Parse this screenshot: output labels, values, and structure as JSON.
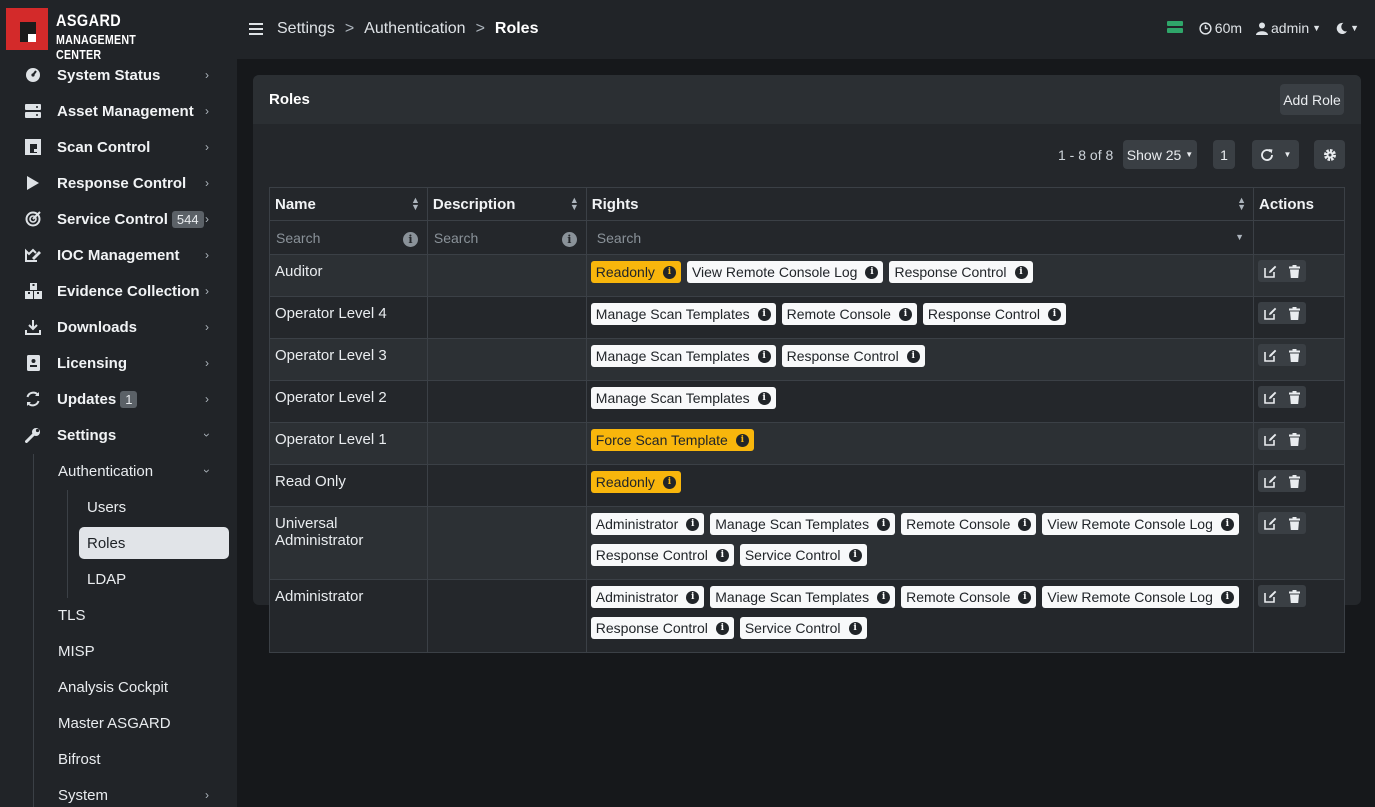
{
  "brand": {
    "line1": "ASGARD",
    "line2": "MANAGEMENT CENTER"
  },
  "sidebar": {
    "items": [
      {
        "label": "System Status",
        "icon": "dashboard-icon"
      },
      {
        "label": "Asset Management",
        "icon": "server-icon"
      },
      {
        "label": "Scan Control",
        "icon": "scan-icon"
      },
      {
        "label": "Response Control",
        "icon": "play-icon"
      },
      {
        "label": "Service Control",
        "icon": "radar-icon",
        "badge": "544"
      },
      {
        "label": "IOC Management",
        "icon": "chart-edit-icon"
      },
      {
        "label": "Evidence Collection",
        "icon": "boxes-icon"
      },
      {
        "label": "Downloads",
        "icon": "download-icon"
      },
      {
        "label": "Licensing",
        "icon": "license-icon"
      },
      {
        "label": "Updates",
        "icon": "sync-icon",
        "badge": "1"
      },
      {
        "label": "Settings",
        "icon": "wrench-icon"
      }
    ],
    "settings_sub": {
      "authentication": "Authentication",
      "auth_items": [
        "Users",
        "Roles",
        "LDAP"
      ],
      "others": [
        "TLS",
        "MISP",
        "Analysis Cockpit",
        "Master ASGARD",
        "Bifrost",
        "System"
      ]
    }
  },
  "topbar": {
    "crumbs": [
      "Settings",
      "Authentication",
      "Roles"
    ],
    "timeout": "60m",
    "user": "admin"
  },
  "card": {
    "title": "Roles",
    "add_button": "Add Role",
    "pager": "1 - 8 of 8",
    "show": "Show 25",
    "page": "1"
  },
  "table": {
    "headers": [
      "Name",
      "Description",
      "Rights",
      "Actions"
    ],
    "search_placeholder": "Search",
    "rows": [
      {
        "name": "Auditor",
        "rights": [
          {
            "t": "Readonly",
            "w": true
          },
          {
            "t": "View Remote Console Log"
          },
          {
            "t": "Response Control"
          }
        ]
      },
      {
        "name": "Operator Level 4",
        "rights": [
          {
            "t": "Manage Scan Templates"
          },
          {
            "t": "Remote Console"
          },
          {
            "t": "Response Control"
          }
        ]
      },
      {
        "name": "Operator Level 3",
        "rights": [
          {
            "t": "Manage Scan Templates"
          },
          {
            "t": "Response Control"
          }
        ]
      },
      {
        "name": "Operator Level 2",
        "rights": [
          {
            "t": "Manage Scan Templates"
          }
        ]
      },
      {
        "name": "Operator Level 1",
        "rights": [
          {
            "t": "Force Scan Template",
            "w": true
          }
        ]
      },
      {
        "name": "Read Only",
        "rights": [
          {
            "t": "Readonly",
            "w": true
          }
        ]
      },
      {
        "name": "Universal Administrator",
        "rights": [
          {
            "t": "Administrator"
          },
          {
            "t": "Manage Scan Templates"
          },
          {
            "t": "Remote Console"
          },
          {
            "t": "View Remote Console Log"
          },
          {
            "t": "Response Control"
          },
          {
            "t": "Service Control"
          }
        ]
      },
      {
        "name": "Administrator",
        "rights": [
          {
            "t": "Administrator"
          },
          {
            "t": "Manage Scan Templates"
          },
          {
            "t": "Remote Console"
          },
          {
            "t": "View Remote Console Log"
          },
          {
            "t": "Response Control"
          },
          {
            "t": "Service Control"
          }
        ]
      }
    ]
  },
  "colors": {
    "warn": "#f8b60c",
    "green": "#2fa66a",
    "brand_red": "#d32a2a"
  }
}
